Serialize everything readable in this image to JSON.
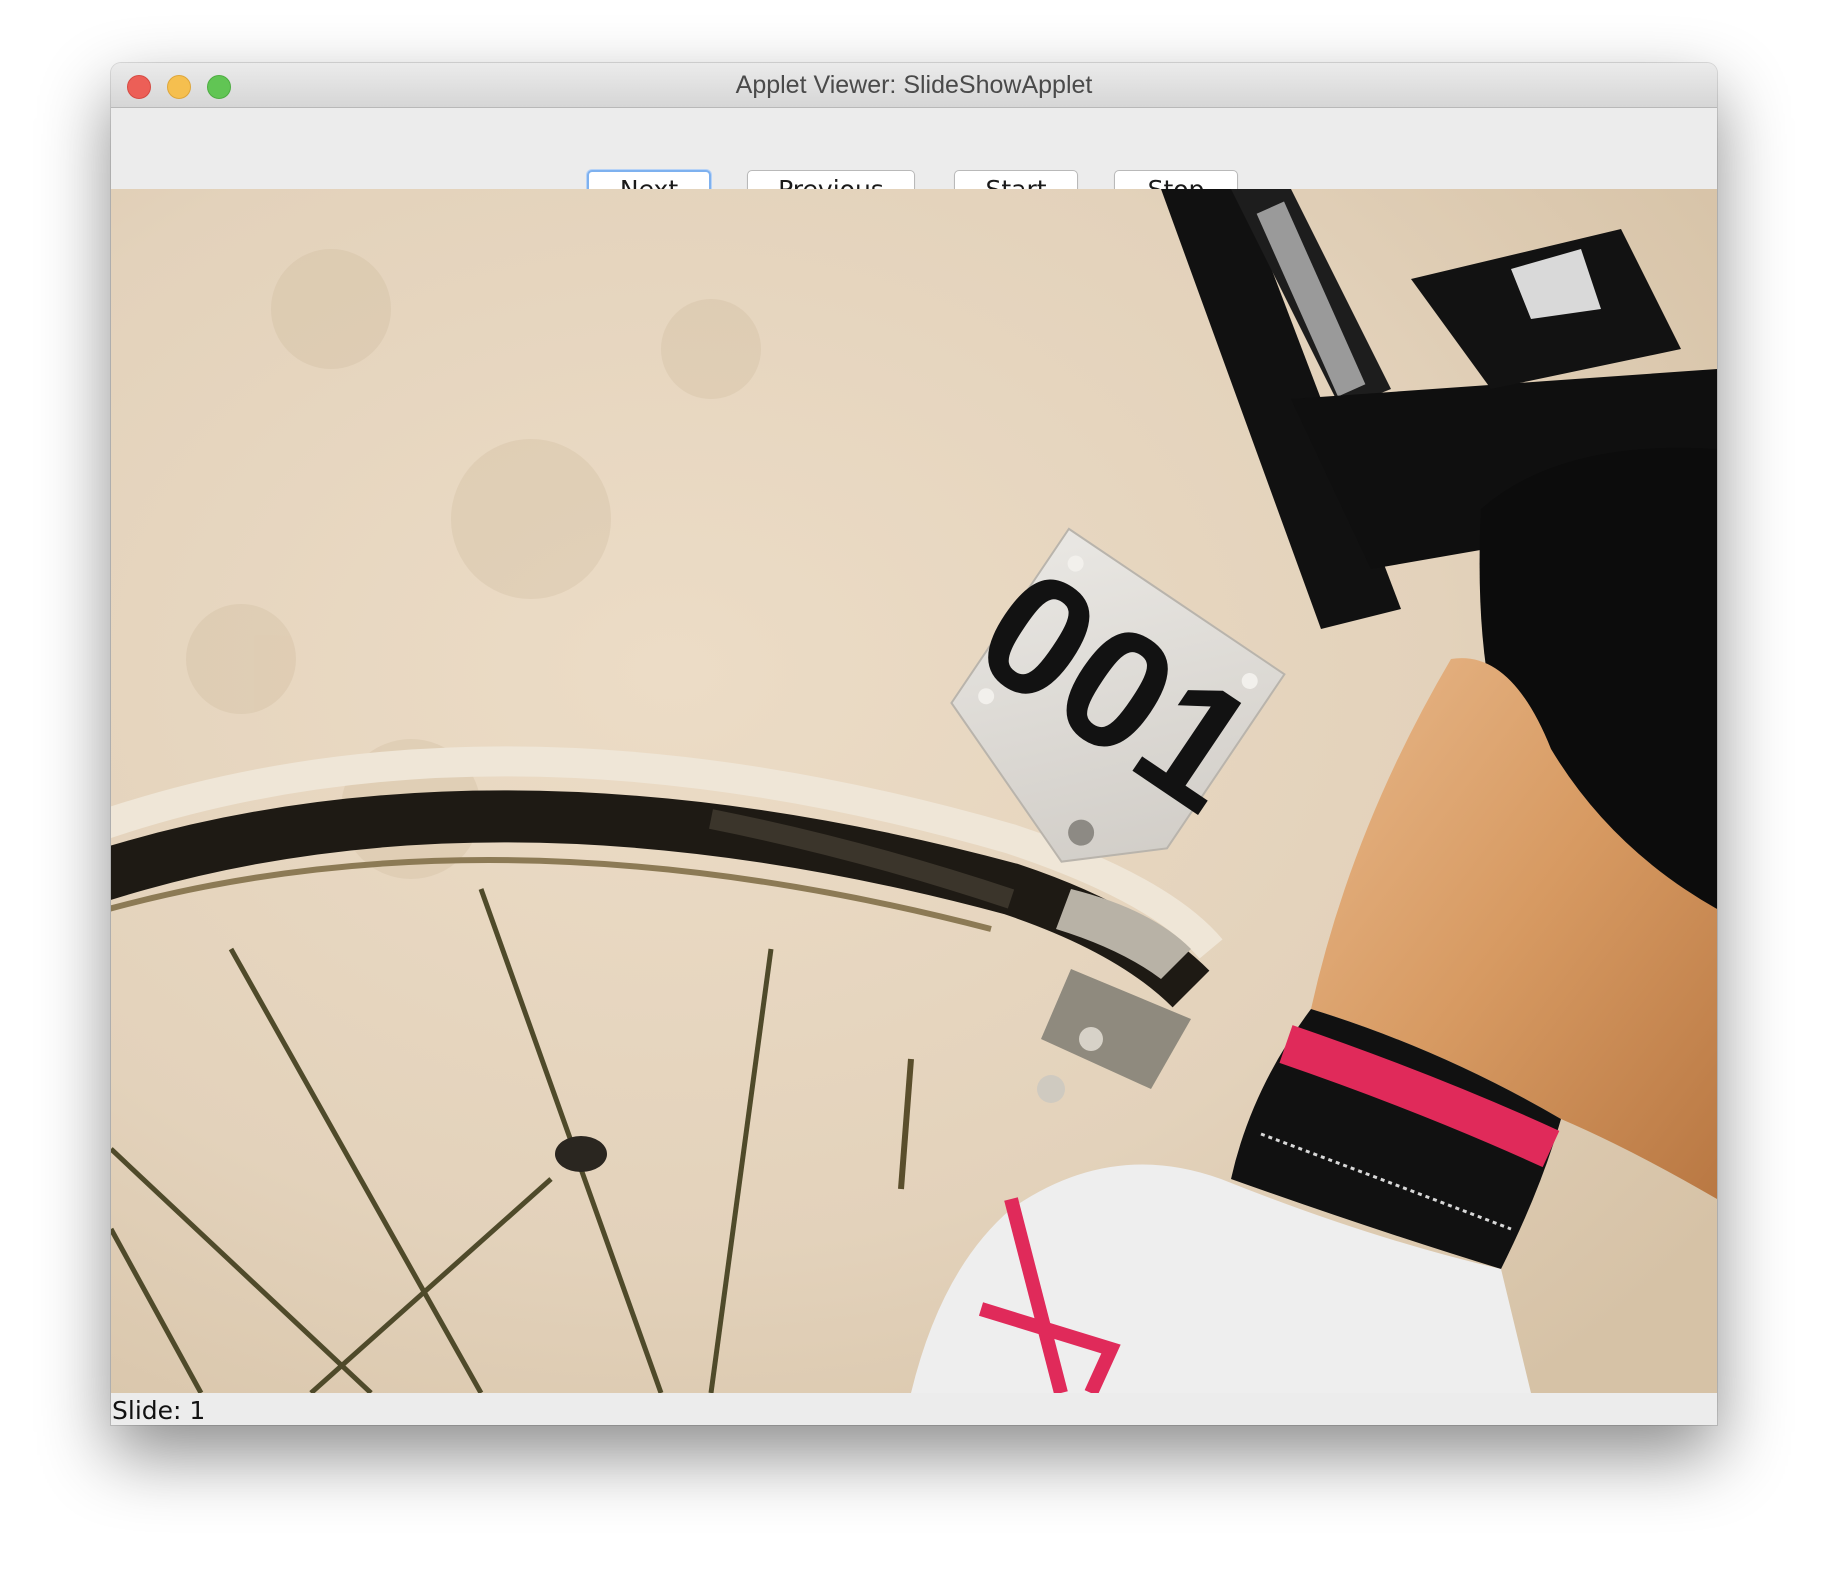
{
  "window": {
    "title": "Applet Viewer: SlideShowApplet"
  },
  "toolbar": {
    "next_label": "Next",
    "previous_label": "Previous",
    "start_label": "Start",
    "stop_label": "Stop"
  },
  "slide": {
    "race_number": "001",
    "status_label": "Slide: 1"
  },
  "colors": {
    "close": "#ec5f57",
    "minimize": "#f5bf4f",
    "maximize": "#61c554",
    "focus_ring": "#7eb1ef",
    "sock_stripe": "#e02a5a"
  }
}
